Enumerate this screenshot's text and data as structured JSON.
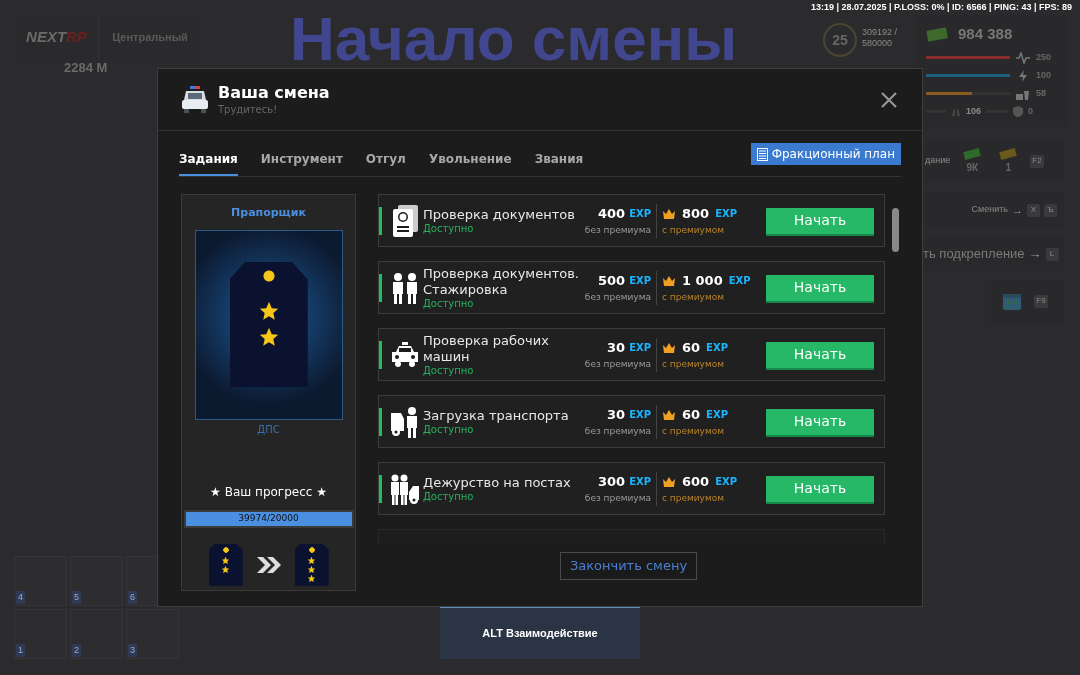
{
  "hud": {
    "logo": {
      "part_1": "NEXT",
      "part_2": "RP"
    },
    "district": "Центральный",
    "distance": "2284 М",
    "banner": "Начало смены",
    "status_line": "13:19 | 28.07.2025 | P.LOSS: 0% | ID: 6566 | PING: 43 | FPS: 89",
    "level": "25",
    "xp": "309192 / 580000",
    "money": "984 388",
    "bars": [
      {
        "kind": "health",
        "level": 1,
        "value": "250"
      },
      {
        "kind": "energy",
        "level": 1,
        "value": "100"
      },
      {
        "kind": "food",
        "level": 0.55,
        "value": "58"
      }
    ],
    "lungs": "106",
    "armor": "0",
    "side_label": "дание",
    "cash_green": "9К",
    "cash_gold": "1",
    "key_f2": "F2",
    "switch_label": "Сменить",
    "switch_arrow": "→",
    "backup_arrow": "→",
    "key_x": "X",
    "key_hard": "Ъ",
    "backup_label": "ть подкрепление",
    "key_l": "L",
    "key_f9": "F9",
    "slots": [
      "4",
      "5",
      "6",
      "1",
      "2",
      "3"
    ],
    "interaction": "ALT Взаимодействие"
  },
  "window": {
    "title": "Ваша смена",
    "subtitle": "Трудитесь!"
  },
  "tabs": [
    {
      "label": "Задания",
      "selected": true
    },
    {
      "label": "Инструмент",
      "selected": false
    },
    {
      "label": "Отгул",
      "selected": false
    },
    {
      "label": "Увольнение",
      "selected": false
    },
    {
      "label": "Звания",
      "selected": false
    }
  ],
  "plan_button": "Фракционный план",
  "rank_card": {
    "rank": "Прапорщик",
    "division": "ДПС",
    "kind": "two_stars",
    "progress_label": "★ Ваш прогресс ★",
    "level": 1,
    "progress_text": "39974/20000",
    "epaulettes": [
      {
        "kind": "two_stars"
      },
      {
        "kind": "three_stars"
      }
    ]
  },
  "tasks": [
    {
      "kind": "documents",
      "title": "Проверка документов",
      "status": "Доступно",
      "exp": "400",
      "exp_tag": "EXP",
      "exp_note": "без премиума",
      "premium_exp": "800",
      "premium_tag": "EXP",
      "premium_note": "с премиумом",
      "button": "Начать"
    },
    {
      "kind": "trainees",
      "title": "Проверка документов. Стажировка",
      "status": "Доступно",
      "exp": "500",
      "exp_tag": "EXP",
      "exp_note": "без премиума",
      "premium_exp": "1 000",
      "premium_tag": "EXP",
      "premium_note": "с премиумом",
      "button": "Начать"
    },
    {
      "kind": "car",
      "title": "Проверка рабочих машин",
      "status": "Доступно",
      "exp": "30",
      "exp_tag": "EXP",
      "exp_note": "без премиума",
      "premium_exp": "60",
      "premium_tag": "EXP",
      "premium_note": "с премиумом",
      "button": "Начать"
    },
    {
      "kind": "transport",
      "title": "Загрузка транспорта",
      "status": "Доступно",
      "exp": "30",
      "exp_tag": "EXP",
      "exp_note": "без премиума",
      "premium_exp": "60",
      "premium_tag": "EXP",
      "premium_note": "с премиумом",
      "button": "Начать"
    },
    {
      "kind": "posts",
      "title": "Дежурство на постах",
      "status": "Доступно",
      "exp": "300",
      "exp_tag": "EXP",
      "exp_note": "без премиума",
      "premium_exp": "600",
      "premium_tag": "EXP",
      "premium_note": "с премиумом",
      "button": "Начать"
    }
  ],
  "finish_button": "Закончить смену"
}
